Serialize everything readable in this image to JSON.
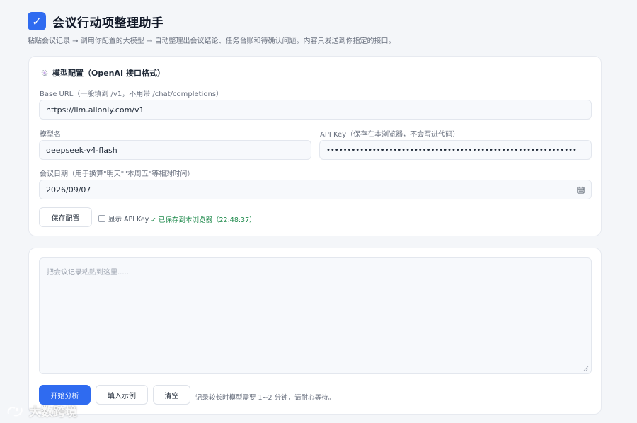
{
  "header": {
    "check_glyph": "✓",
    "title": "会议行动项整理助手",
    "subtitle": "粘贴会议记录 → 调用你配置的大模型 → 自动整理出会议结论、任务台账和待确认问题。内容只发送到你指定的接口。"
  },
  "config": {
    "section_title": "模型配置（OpenAI 接口格式）",
    "base_url": {
      "label": "Base URL（一般填到 /v1，不用带 /chat/completions）",
      "value": "https://llm.aiionly.com/v1"
    },
    "model": {
      "label": "模型名",
      "value": "deepseek-v4-flash"
    },
    "api_key": {
      "label": "API Key（保存在本浏览器，不会写进代码）",
      "masked_value": "••••••••••••••••••••••••••••••••••••••••••••••••••••••••••••"
    },
    "meeting_date": {
      "label": "会议日期（用于换算\"明天\"\"本周五\"等相对时间）",
      "value": "2026/09/07"
    },
    "save_button": "保存配置",
    "show_key_label": "显示 API Key",
    "saved_status": "✓ 已保存到本浏览器（22:48:37）"
  },
  "input": {
    "placeholder": "把会议记录粘贴到这里......",
    "start_button": "开始分析",
    "example_button": "填入示例",
    "clear_button": "清空",
    "hint": "记录较长时模型需要 1~2 分钟，请耐心等待。"
  },
  "watermark": {
    "text": "大数跨境"
  },
  "colors": {
    "accent": "#2f6bf0",
    "success": "#1f8a4c",
    "background": "#f4f6f9"
  },
  "icons": {
    "logo": "check-icon",
    "section": "gear-icon",
    "date": "calendar-icon"
  }
}
